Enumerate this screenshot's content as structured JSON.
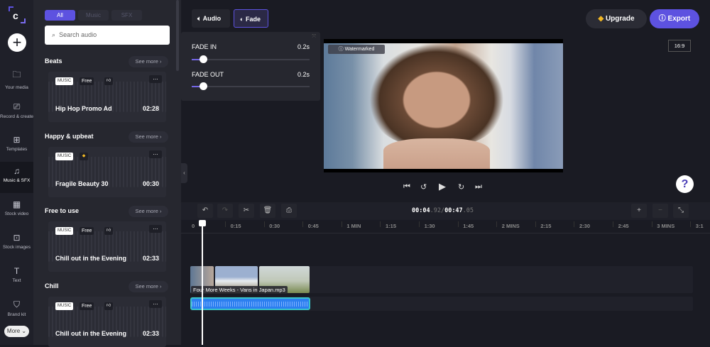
{
  "nav": {
    "items": [
      {
        "label": "Your media",
        "icon": "folder-icon"
      },
      {
        "label": "Record & create",
        "icon": "camera-icon"
      },
      {
        "label": "Templates",
        "icon": "templates-icon"
      },
      {
        "label": "Music & SFX",
        "icon": "music-icon",
        "active": true
      },
      {
        "label": "Stock video",
        "icon": "film-icon"
      },
      {
        "label": "Stock images",
        "icon": "image-icon"
      },
      {
        "label": "Text",
        "icon": "text-icon"
      },
      {
        "label": "Brand kit",
        "icon": "brand-icon"
      }
    ],
    "more": "More ⌄"
  },
  "panel": {
    "tabs": [
      "All",
      "Music",
      "SFX"
    ],
    "search_placeholder": "Search audio",
    "see_more": "See more  ›",
    "sections": [
      {
        "title": "Beats",
        "track": {
          "badges": [
            "MUSIC",
            "Free"
          ],
          "title": "Hip Hop Promo Ad",
          "duration": "02:28",
          "premium": false
        }
      },
      {
        "title": "Happy & upbeat",
        "track": {
          "badges": [
            "MUSIC"
          ],
          "title": "Fragile Beauty 30",
          "duration": "00:30",
          "premium": true
        }
      },
      {
        "title": "Free to use",
        "track": {
          "badges": [
            "MUSIC",
            "Free"
          ],
          "title": "Chill out in the Evening",
          "duration": "02:33",
          "premium": false
        }
      },
      {
        "title": "Chill",
        "track": {
          "badges": [
            "MUSIC",
            "Free"
          ],
          "title": "Chill out in the Evening",
          "duration": "02:33",
          "premium": false
        }
      }
    ]
  },
  "toolbar": {
    "audio": "Audio",
    "fade": "Fade",
    "upgrade": "Upgrade",
    "export": "Export"
  },
  "fade": {
    "fade_in_label": "FADE IN",
    "fade_in_value": "0.2s",
    "fade_out_label": "FADE OUT",
    "fade_out_value": "0.2s"
  },
  "preview": {
    "watermark": "Watermarked",
    "aspect": "16:9"
  },
  "timeline": {
    "current": "00:04",
    "current_frac": ".92",
    "separator": "/",
    "total": "00:47",
    "total_frac": ".05",
    "ticks": [
      "0",
      "0:15",
      "0:30",
      "0:45",
      "1 MIN",
      "1:15",
      "1:30",
      "1:45",
      "2 MINS",
      "2:15",
      "2:30",
      "2:45",
      "3 MINS",
      "3:1"
    ],
    "clip_name": "Four More Weeks - Vans in Japan.mp3"
  },
  "colors": {
    "accent": "#5d52e0",
    "audio_clip": "#2c7ff0",
    "audio_border": "#39c4c9"
  }
}
